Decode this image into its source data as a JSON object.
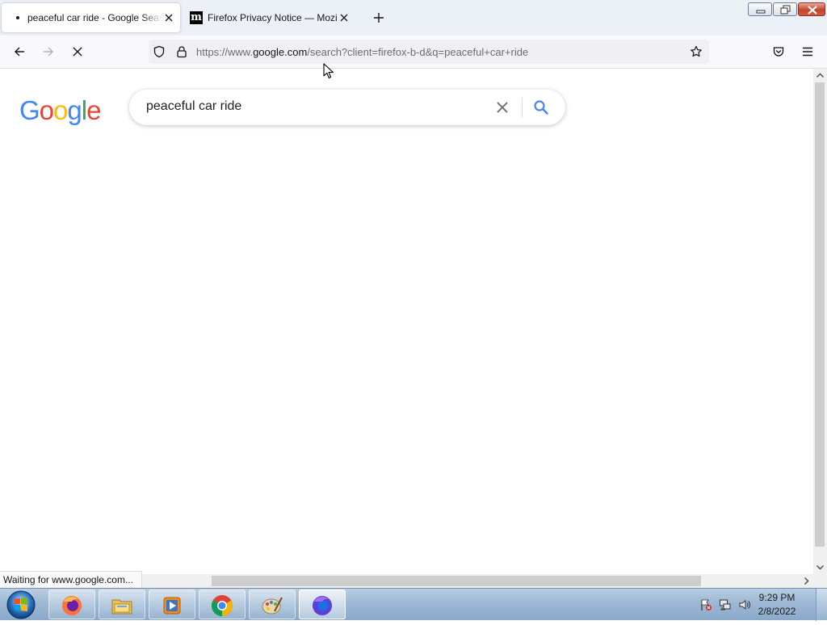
{
  "browser": {
    "tabs": [
      {
        "title": "peaceful car ride - Google Search",
        "active": true
      },
      {
        "title": "Firefox Privacy Notice — Mozilla",
        "active": false,
        "favicon_letter": "m"
      }
    ],
    "url": {
      "prefix": "https://www.",
      "domain": "google.com",
      "path": "/search?client=firefox-b-d&q=peaceful+car+ride"
    },
    "status_text": "Waiting for www.google.com..."
  },
  "page": {
    "logo_letters": [
      {
        "char": "G",
        "color": "#4285F4"
      },
      {
        "char": "o",
        "color": "#EA4335"
      },
      {
        "char": "o",
        "color": "#FBBC05"
      },
      {
        "char": "g",
        "color": "#4285F4"
      },
      {
        "char": "l",
        "color": "#34A853"
      },
      {
        "char": "e",
        "color": "#EA4335"
      }
    ],
    "search_query": "peaceful car ride"
  },
  "taskbar": {
    "apps": [
      "firefox-icon",
      "file-explorer-icon",
      "media-player-icon",
      "chrome-icon",
      "paint-icon",
      "firefox-active-icon"
    ],
    "clock_time": "9:29 PM",
    "clock_date": "2/8/2022"
  },
  "colors": {
    "accent_blue": "#4285F4",
    "tabstrip_bg": "#ecf1f7",
    "taskbar_blue": "#9db8d4"
  }
}
